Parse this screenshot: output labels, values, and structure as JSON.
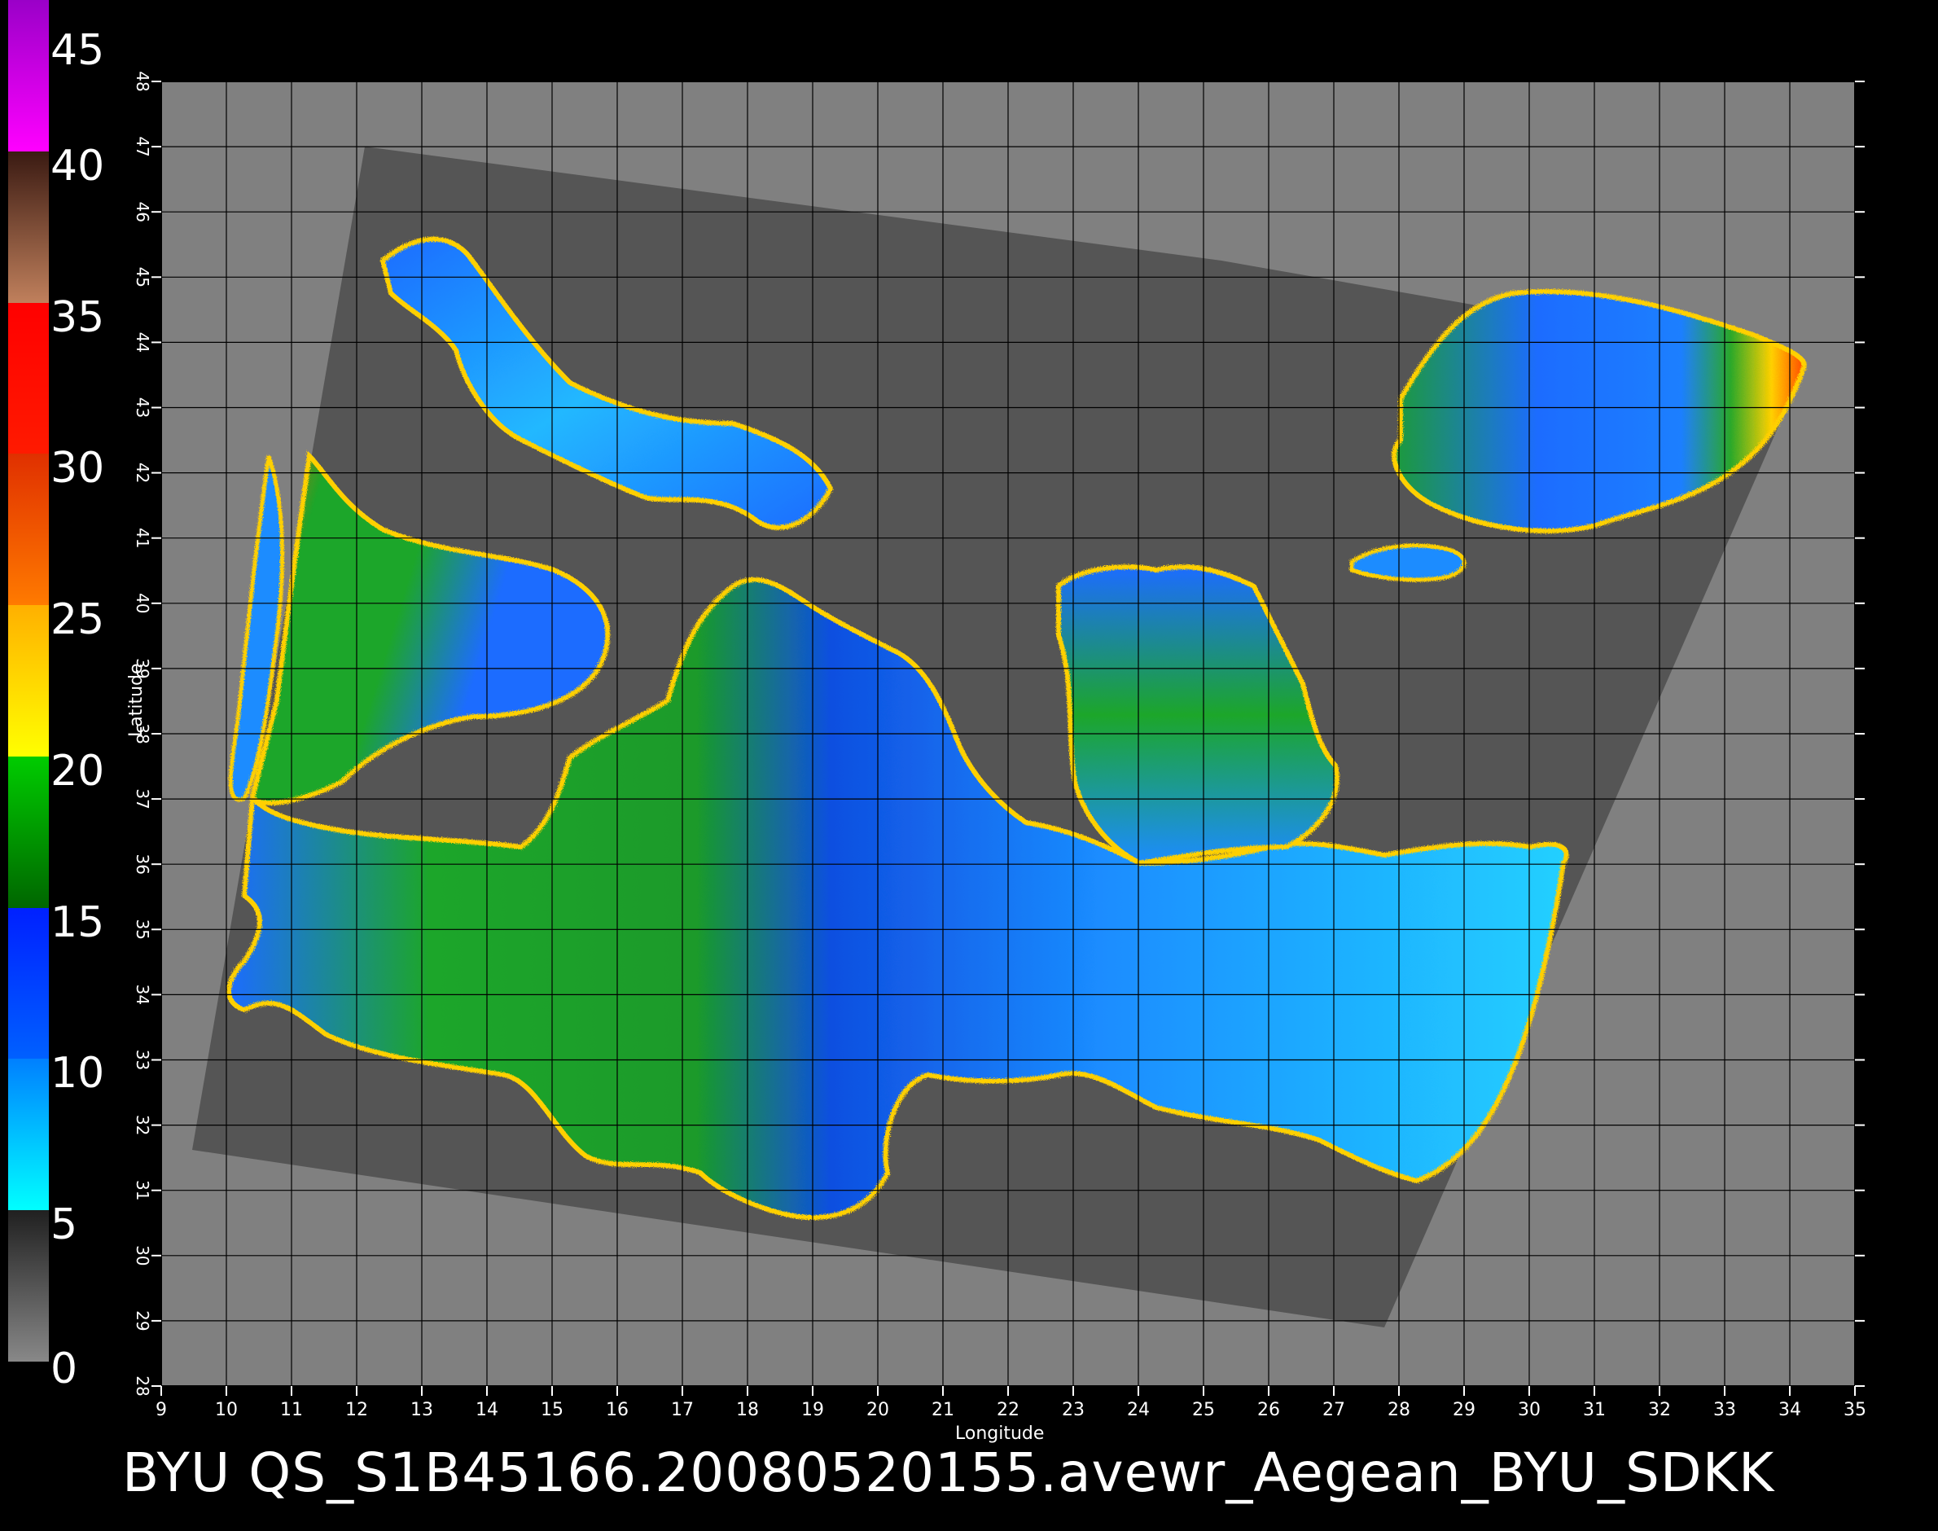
{
  "map": {
    "xlabel": "Longitude",
    "ylabel": "Latitude",
    "lon_range": [
      9,
      35
    ],
    "lat_range": [
      28,
      48
    ],
    "lon_ticks": [
      "9",
      "10",
      "11",
      "12",
      "13",
      "14",
      "15",
      "16",
      "17",
      "18",
      "19",
      "20",
      "21",
      "22",
      "23",
      "24",
      "25",
      "26",
      "27",
      "28",
      "29",
      "30",
      "31",
      "32",
      "33",
      "34",
      "35"
    ],
    "lat_ticks": [
      "28",
      "29",
      "30",
      "31",
      "32",
      "33",
      "34",
      "35",
      "36",
      "37",
      "38",
      "39",
      "40",
      "41",
      "42",
      "43",
      "44",
      "45",
      "46",
      "47",
      "48"
    ],
    "grid": "on",
    "background_color": "#808080",
    "swath_color": "#545454",
    "frame_color": "#000000"
  },
  "colorbar": {
    "labels": [
      "45",
      "40",
      "35",
      "30",
      "25",
      "20",
      "15",
      "10",
      "5",
      "0"
    ],
    "segments": [
      {
        "range": [
          40,
          45
        ],
        "top": "#9a00c8",
        "bottom": "#ff00ff"
      },
      {
        "range": [
          35,
          40
        ],
        "top": "#3a1a12",
        "bottom": "#c0805c"
      },
      {
        "range": [
          30,
          35
        ],
        "top": "#ff0000",
        "bottom": "#ff1a00"
      },
      {
        "range": [
          25,
          30
        ],
        "top": "#e03000",
        "bottom": "#ff7a00"
      },
      {
        "range": [
          20,
          25
        ],
        "top": "#ffb000",
        "bottom": "#ffff00"
      },
      {
        "range": [
          15,
          20
        ],
        "top": "#00cc00",
        "bottom": "#006600"
      },
      {
        "range": [
          10,
          15
        ],
        "top": "#0020ff",
        "bottom": "#0060ff"
      },
      {
        "range": [
          5,
          10
        ],
        "top": "#0080ff",
        "bottom": "#00ffff"
      },
      {
        "range": [
          0,
          5
        ],
        "top": "#202020",
        "bottom": "#888888"
      }
    ]
  },
  "footer": {
    "title": "BYU  QS_S1B45166.20080520155.avewr_Aegean_BYU_SDKK"
  }
}
